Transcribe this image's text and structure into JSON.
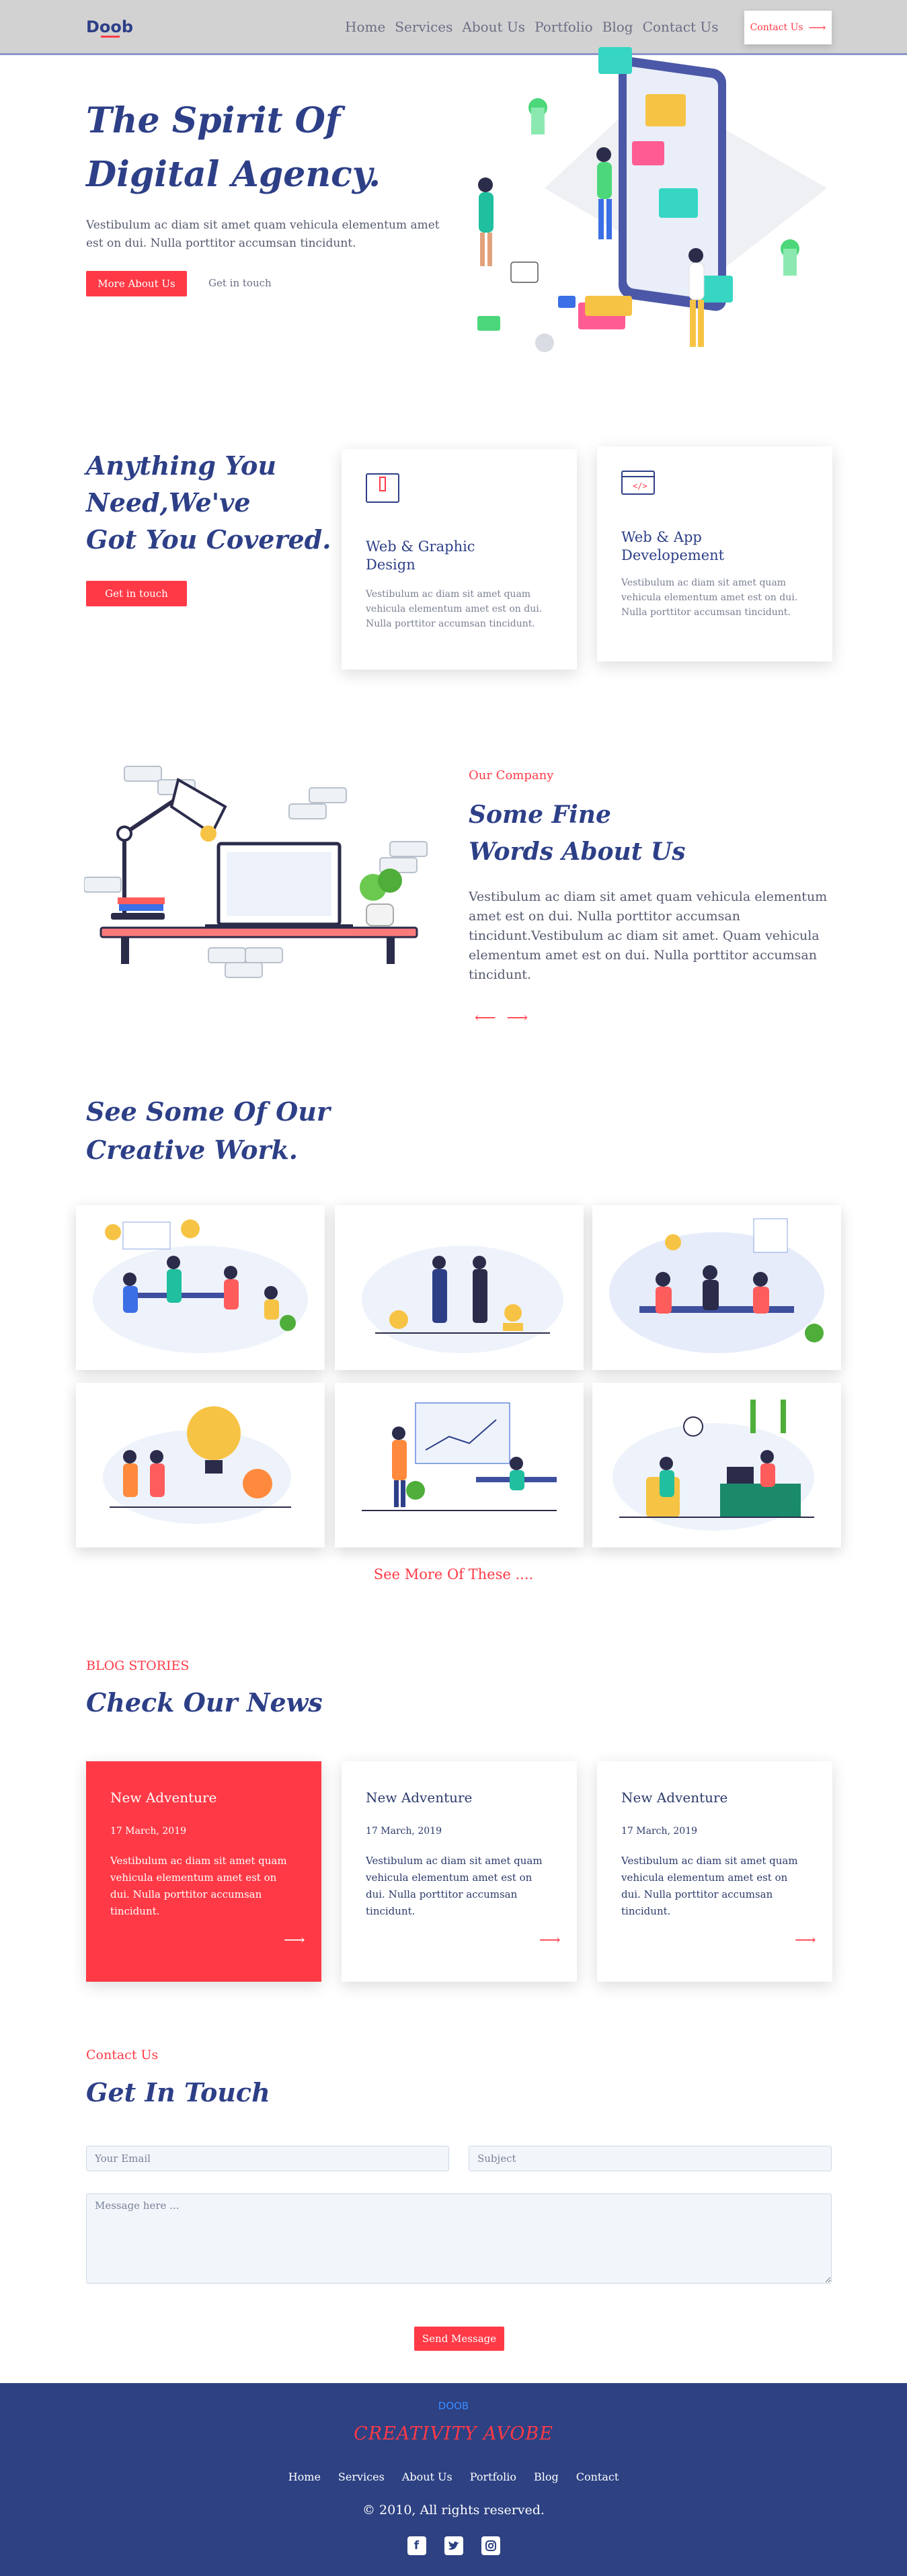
{
  "header": {
    "logo": "Doob",
    "nav": [
      "Home",
      "Services",
      "About Us",
      "Portfolio",
      "Blog",
      "Contact Us"
    ],
    "cta": "Contact Us",
    "bg_color": "#d2d2d2"
  },
  "hero": {
    "title_line1": "The Spirit Of",
    "title_line2": "Digital Agency.",
    "text": "Vestibulum ac diam sit amet quam vehicula elementum amet est on dui. Nulla porttitor accumsan tincidunt.",
    "primary_button": "More About Us",
    "secondary_link": "Get in touch"
  },
  "services": {
    "title_line1": "Anything You",
    "title_line2": "Need,We've",
    "title_line3": "Got You Covered.",
    "button": "Get in touch",
    "cards": [
      {
        "icon": "envelope-icon",
        "title_line1": "Web & Graphic",
        "title_line2": "Design",
        "text": "Vestibulum ac diam sit amet quam vehicula elementum amet est on dui. Nulla porttitor accumsan tincidunt."
      },
      {
        "icon": "code-window-icon",
        "title_line1": "Web & App",
        "title_line2": "Developement",
        "text": "Vestibulum ac diam sit amet quam vehicula elementum amet est on dui. Nulla porttitor accumsan tincidunt."
      }
    ]
  },
  "about": {
    "eyebrow": "Our Company",
    "title_line1": "Some Fine",
    "title_line2": "Words About Us",
    "text": "Vestibulum ac diam sit amet quam vehicula elementum amet est on dui. Nulla porttitor accumsan tincidunt.Vestibulum ac diam sit amet. Quam vehicula elementum amet est on dui. Nulla porttitor accumsan tincidunt."
  },
  "portfolio": {
    "title_line1": "See Some Of Our",
    "title_line2": "Creative Work.",
    "see_more": "See More Of These ...."
  },
  "blog": {
    "eyebrow": "BLOG STORIES",
    "title": "Check Our News",
    "posts": [
      {
        "title": "New Adventure",
        "date": "17 March, 2019",
        "text": "Vestibulum ac diam sit amet quam vehicula elementum amet est on dui. Nulla porttitor accumsan tincidunt."
      },
      {
        "title": "New Adventure",
        "date": "17 March, 2019",
        "text": "Vestibulum ac diam sit amet quam vehicula elementum amet est on dui. Nulla porttitor accumsan tincidunt."
      },
      {
        "title": "New Adventure",
        "date": "17 March, 2019",
        "text": "Vestibulum ac diam sit amet quam vehicula elementum amet est on dui. Nulla porttitor accumsan tincidunt."
      }
    ]
  },
  "contact": {
    "eyebrow": "Contact Us",
    "title": "Get In Touch",
    "email_placeholder": "Your Email",
    "subject_placeholder": "Subject",
    "message_placeholder": "Message here ...",
    "send": "Send Message"
  },
  "footer": {
    "logo": "DOOB",
    "tagline": "CREATIVITY AVOBE",
    "nav": [
      "Home",
      "Services",
      "About Us",
      "Portfolio",
      "Blog",
      "Contact"
    ],
    "copyright": "© 2010, All rights reserved.",
    "social": [
      "facebook-icon",
      "twitter-icon",
      "instagram-icon"
    ]
  },
  "colors": {
    "accent": "#ff3a46",
    "brand": "#2d3f87",
    "footer_bg": "#2d4183"
  }
}
